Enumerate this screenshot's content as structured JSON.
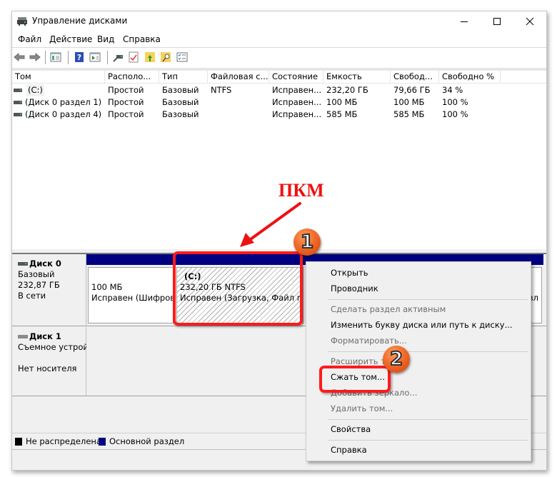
{
  "window": {
    "title": "Управление дисками",
    "icon": "disk-management-icon",
    "controls": {
      "minimize": "minimize-icon",
      "maximize": "maximize-icon",
      "close": "close-icon"
    }
  },
  "menubar": {
    "items": [
      "Файл",
      "Действие",
      "Вид",
      "Справка"
    ]
  },
  "toolbar": {
    "buttons": [
      "back-icon",
      "forward-icon",
      "show-hide-console-tree-icon",
      "help-icon",
      "show-hide-action-pane-icon",
      "connect-disk-icon",
      "checkmark-doc-icon",
      "export-folder-icon",
      "search-folder-icon",
      "properties-list-icon"
    ]
  },
  "volumes": {
    "columns": [
      "Том",
      "Располо...",
      "Тип",
      "Файловая с...",
      "Состояние",
      "Емкость",
      "Свобод...",
      "Свободно %"
    ],
    "rows": [
      {
        "name": "(C:)",
        "layout": "Простой",
        "type": "Базовый",
        "fs": "NTFS",
        "status": "Исправен...",
        "capacity": "232,20 ГБ",
        "free": "79,66 ГБ",
        "free_pct": "34 %"
      },
      {
        "name": "(Диск 0 раздел 1)",
        "layout": "Простой",
        "type": "Базовый",
        "fs": "",
        "status": "Исправен...",
        "capacity": "100 МБ",
        "free": "100 МБ",
        "free_pct": "100 %"
      },
      {
        "name": "(Диск 0 раздел 4)",
        "layout": "Простой",
        "type": "Базовый",
        "fs": "",
        "status": "Исправен...",
        "capacity": "585 МБ",
        "free": "585 МБ",
        "free_pct": "100 %"
      }
    ]
  },
  "disks": [
    {
      "name": "Диск 0",
      "type": "Базовый",
      "size": "232,87 ГБ",
      "state": "В сети",
      "partitions": [
        {
          "label": "",
          "size": "100 МБ",
          "status": "Исправен (Шифрова"
        },
        {
          "label": "(C:)",
          "size": "232,20 ГБ NTFS",
          "status": "Исправен (Загрузка, Файл подк"
        },
        {
          "label": "",
          "size": "",
          "status": ""
        },
        {
          "label": "",
          "size": "",
          "status": "вл"
        }
      ]
    },
    {
      "name": "Диск 1",
      "type": "Съемное устрой",
      "size": "",
      "state": "Нет носителя"
    }
  ],
  "legend": [
    {
      "label": "Не распределена",
      "color": "#000000"
    },
    {
      "label": "Основной раздел",
      "color": "#000080"
    }
  ],
  "context_menu": {
    "items": [
      {
        "label": "Открыть",
        "enabled": true
      },
      {
        "label": "Проводник",
        "enabled": true
      },
      {
        "label": "Сделать раздел активным",
        "enabled": false
      },
      {
        "label": "Изменить букву диска или путь к диску...",
        "enabled": true
      },
      {
        "label": "Форматировать...",
        "enabled": false
      },
      {
        "label": "Расширить том...",
        "enabled": false
      },
      {
        "label": "Сжать том...",
        "enabled": true
      },
      {
        "label": "Добавить зеркало...",
        "enabled": false
      },
      {
        "label": "Удалить том...",
        "enabled": false
      },
      {
        "label": "Свойства",
        "enabled": true
      },
      {
        "label": "Справка",
        "enabled": true
      }
    ]
  },
  "annotations": {
    "pkm_label": "ПКМ",
    "step1": "1",
    "step2": "2",
    "accent_color": "#ff1a1a"
  }
}
